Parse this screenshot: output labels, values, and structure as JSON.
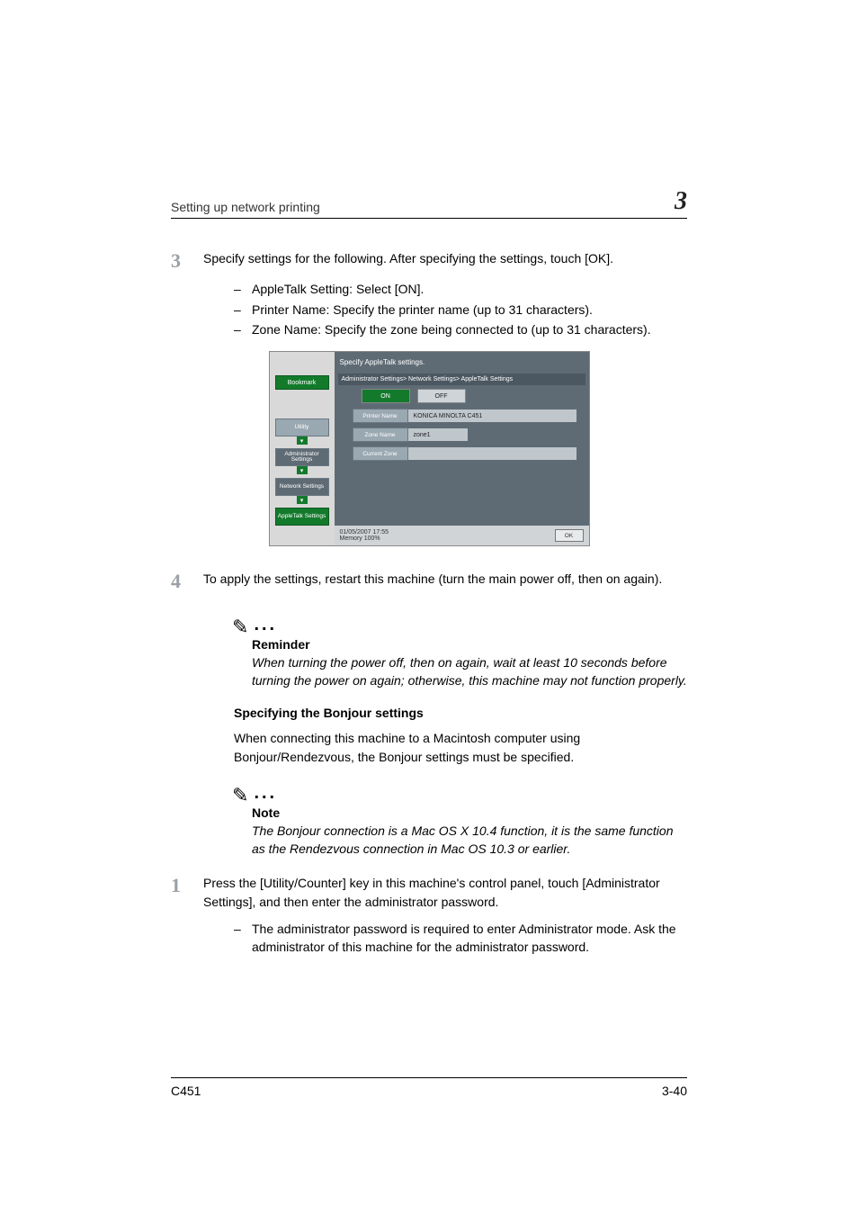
{
  "header": {
    "left": "Setting up network printing",
    "chapter": "3"
  },
  "step3": {
    "num": "3",
    "text": "Specify settings for the following. After specifying the settings, touch [OK].",
    "items": [
      "AppleTalk Setting: Select [ON].",
      "Printer Name: Specify the printer name (up to 31 characters).",
      "Zone Name: Specify the zone being connected to (up to 31 characters)."
    ]
  },
  "ui": {
    "title": "Specify AppleTalk settings.",
    "bookmark": "Bookmark",
    "nav": {
      "utility": "Utility",
      "admin": "Administrator Settings",
      "network": "Network Settings",
      "apple": "AppleTalk Settings"
    },
    "crumb": "Administrator Settings> Network Settings> AppleTalk Settings",
    "on": "ON",
    "off": "OFF",
    "printer_label": "Printer Name",
    "printer_val": "KONICA MINOLTA C451",
    "zone_label": "Zone Name",
    "zone_val": "zone1",
    "curzone_label": "Current Zone",
    "date": "01/05/2007   17:55",
    "mem": "Memory        100%",
    "ok": "OK"
  },
  "step4": {
    "num": "4",
    "text": "To apply the settings, restart this machine (turn the main power off, then on again)."
  },
  "reminder": {
    "head": "Reminder",
    "body": "When turning the power off, then on again, wait at least 10 seconds before turning the power on again; otherwise, this machine may not function properly."
  },
  "bonjour_head": "Specifying the Bonjour settings",
  "bonjour_para": "When connecting this machine to a Macintosh computer using Bonjour/Rendezvous, the Bonjour settings must be specified.",
  "note": {
    "head": "Note",
    "body": "The Bonjour connection is a Mac OS X 10.4 function, it is the same function as the Rendezvous connection in Mac OS 10.3 or earlier."
  },
  "step1": {
    "num": "1",
    "text": "Press the [Utility/Counter] key in this machine's control panel, touch [Administrator Settings], and then enter the administrator password.",
    "items": [
      "The administrator password is required to enter Administrator mode. Ask the administrator of this machine for the administrator password."
    ]
  },
  "footer": {
    "left": "C451",
    "right": "3-40"
  }
}
